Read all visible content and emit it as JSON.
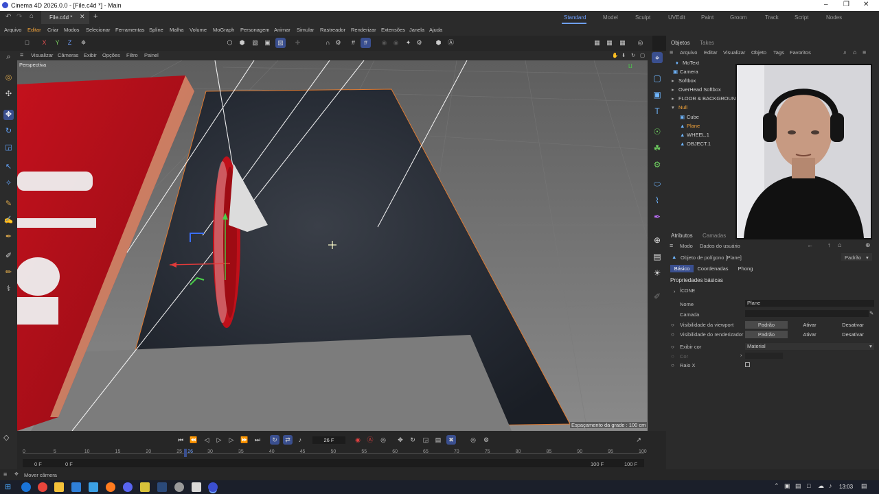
{
  "window": {
    "title": "Cinema 4D 2026.0.0 - [File.c4d *] - Main",
    "tab": "File.c4d *"
  },
  "layouts": [
    "Standard",
    "Model",
    "Sculpt",
    "UVEdit",
    "Paint",
    "Groom",
    "Track",
    "Script",
    "Nodes"
  ],
  "menu": [
    "Arquivo",
    "Editar",
    "Criar",
    "Modos",
    "Selecionar",
    "Ferramentas",
    "Spline",
    "Malha",
    "Volume",
    "MoGraph",
    "Personagem",
    "Animar",
    "Simular",
    "Rastreador",
    "Renderizar",
    "Extensões",
    "Janela",
    "Ajuda"
  ],
  "toolbar": {
    "x": "X",
    "y": "Y",
    "z": "Z"
  },
  "viewport": {
    "menu": [
      "Visualizar",
      "Câmeras",
      "Exibir",
      "Opções",
      "Filtro",
      "Painel"
    ],
    "label": "Perspectiva",
    "grid_spacing": "Espaçamento da grade : 100 cm"
  },
  "objects": {
    "tabs": [
      "Objetos",
      "Takes"
    ],
    "menu": [
      "Arquivo",
      "Editar",
      "Visualizar",
      "Objeto",
      "Tags",
      "Favoritos"
    ],
    "items": [
      {
        "name": "MoText",
        "icon": "motext-icon"
      },
      {
        "name": "Camera",
        "icon": "camera-icon"
      },
      {
        "name": "Softbox",
        "icon": "null-icon"
      },
      {
        "name": "OverHead Softbox",
        "icon": "null-icon"
      },
      {
        "name": "FLOOR & BACKGROUND",
        "icon": "null-icon"
      },
      {
        "name": "Null",
        "icon": "null-icon",
        "selected": true
      },
      {
        "name": "Cube",
        "icon": "cube-icon"
      },
      {
        "name": "Plane",
        "icon": "plane-icon",
        "selected": true
      },
      {
        "name": "WHEEL.1",
        "icon": "polygon-icon"
      },
      {
        "name": "OBJECT.1",
        "icon": "polygon-icon"
      }
    ]
  },
  "attributes": {
    "tabs": [
      "Atributos",
      "Camadas"
    ],
    "menu": [
      "Modo",
      "Dados do usuário"
    ],
    "object_label": "Objeto de polígono [Plane]",
    "preset": "Padrão",
    "subtabs": [
      "Básico",
      "Coordenadas",
      "Phong"
    ],
    "section": "Propriedades básicas",
    "icon_group": "ÍCONE",
    "name_label": "Nome",
    "name_value": "Plane",
    "layer_label": "Camada",
    "vis_viewport_label": "Visibilidade da viewport",
    "vis_render_label": "Visibilidade do renderizador",
    "vis_options": [
      "Padrão",
      "Ativar",
      "Desativar"
    ],
    "display_color_label": "Exibir cor",
    "display_color_value": "Material",
    "color_label": "Cor",
    "xray_label": "Raio X"
  },
  "timeline": {
    "current_frame": "26 F",
    "ticks": [
      "0",
      "5",
      "10",
      "15",
      "20",
      "25",
      "30",
      "35",
      "40",
      "45",
      "50",
      "55",
      "60",
      "65",
      "70",
      "75",
      "80",
      "85",
      "90",
      "95",
      "100"
    ],
    "playhead_value": "26",
    "start_a": "0 F",
    "start_b": "0 F",
    "end_a": "100 F",
    "end_b": "100 F"
  },
  "status": {
    "text": "Mover câmera"
  },
  "taskbar": {
    "time": "13:03"
  },
  "colors": {
    "accent": "#3a4f8f",
    "selected": "#f2a33a",
    "red_sign": "#b3101a"
  }
}
